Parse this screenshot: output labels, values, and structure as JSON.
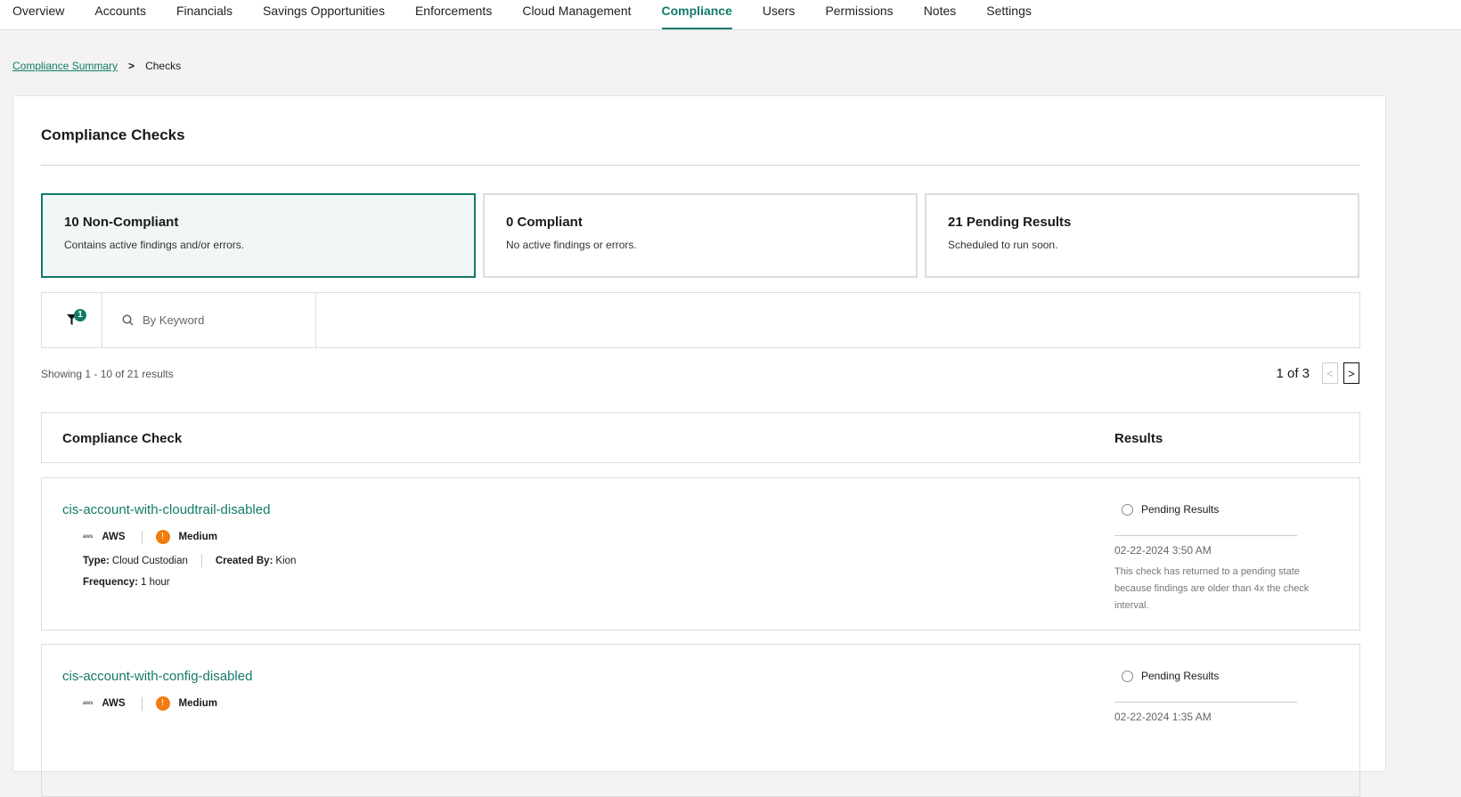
{
  "nav": {
    "items": [
      "Overview",
      "Accounts",
      "Financials",
      "Savings Opportunities",
      "Enforcements",
      "Cloud Management",
      "Compliance",
      "Users",
      "Permissions",
      "Notes",
      "Settings"
    ],
    "active": "Compliance"
  },
  "breadcrumb": {
    "parent": "Compliance Summary",
    "current": "Checks"
  },
  "page": {
    "title": "Compliance Checks"
  },
  "summary": [
    {
      "title": "10 Non-Compliant",
      "desc": "Contains active findings and/or errors.",
      "selected": true
    },
    {
      "title": "0 Compliant",
      "desc": "No active findings or errors."
    },
    {
      "title": "21 Pending Results",
      "desc": "Scheduled to run soon."
    }
  ],
  "filter": {
    "badge": "1",
    "search_placeholder": "By Keyword"
  },
  "results": {
    "showing": "Showing 1 - 10 of 21 results",
    "page": "1 of 3"
  },
  "table": {
    "headers": [
      "Compliance Check",
      "Results"
    ],
    "rows": [
      {
        "name": "cis-account-with-cloudtrail-disabled",
        "provider": "AWS",
        "severity": "Medium",
        "type_label": "Type:",
        "type": "Cloud Custodian",
        "created_label": "Created By:",
        "created": "Kion",
        "freq_label": "Frequency:",
        "freq": "1 hour",
        "status": "Pending Results",
        "date": "02-22-2024 3:50 AM",
        "message": "This check has returned to a pending state because findings are older than 4x the check interval."
      },
      {
        "name": "cis-account-with-config-disabled",
        "provider": "AWS",
        "severity": "Medium",
        "status": "Pending Results",
        "date": "02-22-2024 1:35 AM"
      }
    ]
  },
  "colors": {
    "accent": "#137a6a",
    "warning": "#f07d12"
  }
}
